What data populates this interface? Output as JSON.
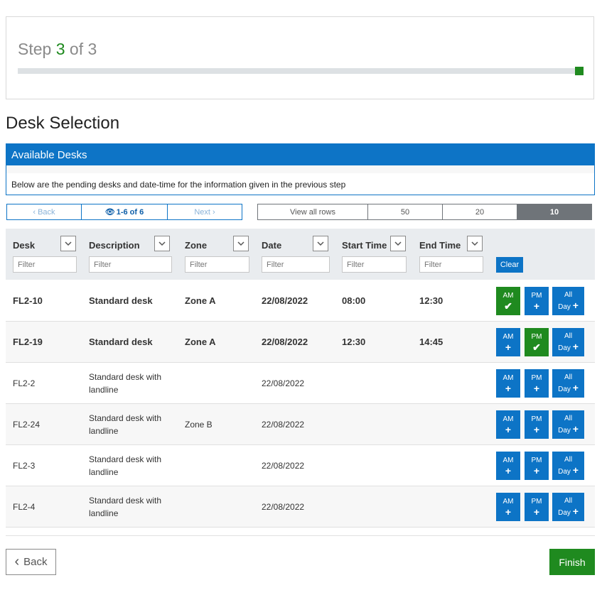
{
  "step": {
    "prefix": "Step",
    "current": "3",
    "suffix": "of 3",
    "progress": 1.0
  },
  "section_title": "Desk Selection",
  "panel": {
    "title": "Available Desks",
    "description": "Below are the pending desks and date-time for the information given in the previous step"
  },
  "pager": {
    "back": "Back",
    "range": "1-6 of 6",
    "next": "Next"
  },
  "rows_options": [
    "View all rows",
    "50",
    "20",
    "10"
  ],
  "rows_selected": "10",
  "columns": [
    "Desk",
    "Description",
    "Zone",
    "Date",
    "Start Time",
    "End Time"
  ],
  "filter_placeholder": "Filter",
  "clear_label": "Clear",
  "buttons": {
    "am": "AM",
    "pm": "PM",
    "all1": "All",
    "all2": "Day"
  },
  "desks": [
    {
      "desk": "FL2-10",
      "description": "Standard desk",
      "zone": "Zone A",
      "date": "22/08/2022",
      "start": "08:00",
      "end": "12:30",
      "bold": true,
      "am": true,
      "pm": false,
      "allday": false
    },
    {
      "desk": "FL2-19",
      "description": "Standard desk",
      "zone": "Zone A",
      "date": "22/08/2022",
      "start": "12:30",
      "end": "14:45",
      "bold": true,
      "am": false,
      "pm": true,
      "allday": false
    },
    {
      "desk": "FL2-2",
      "description": "Standard desk with landline",
      "zone": "",
      "date": "22/08/2022",
      "start": "",
      "end": "",
      "bold": false,
      "am": false,
      "pm": false,
      "allday": false
    },
    {
      "desk": "FL2-24",
      "description": "Standard desk with landline",
      "zone": "Zone B",
      "date": "22/08/2022",
      "start": "",
      "end": "",
      "bold": false,
      "am": false,
      "pm": false,
      "allday": false
    },
    {
      "desk": "FL2-3",
      "description": "Standard desk with landline",
      "zone": "",
      "date": "22/08/2022",
      "start": "",
      "end": "",
      "bold": false,
      "am": false,
      "pm": false,
      "allday": false
    },
    {
      "desk": "FL2-4",
      "description": "Standard desk with landline",
      "zone": "",
      "date": "22/08/2022",
      "start": "",
      "end": "",
      "bold": false,
      "am": false,
      "pm": false,
      "allday": false
    }
  ],
  "footer": {
    "back": "Back",
    "finish": "Finish"
  },
  "colors": {
    "primary": "#0d74c6",
    "success": "#1f8a1f",
    "header_bg": "#e9ecef",
    "dark": "#6f7479"
  }
}
